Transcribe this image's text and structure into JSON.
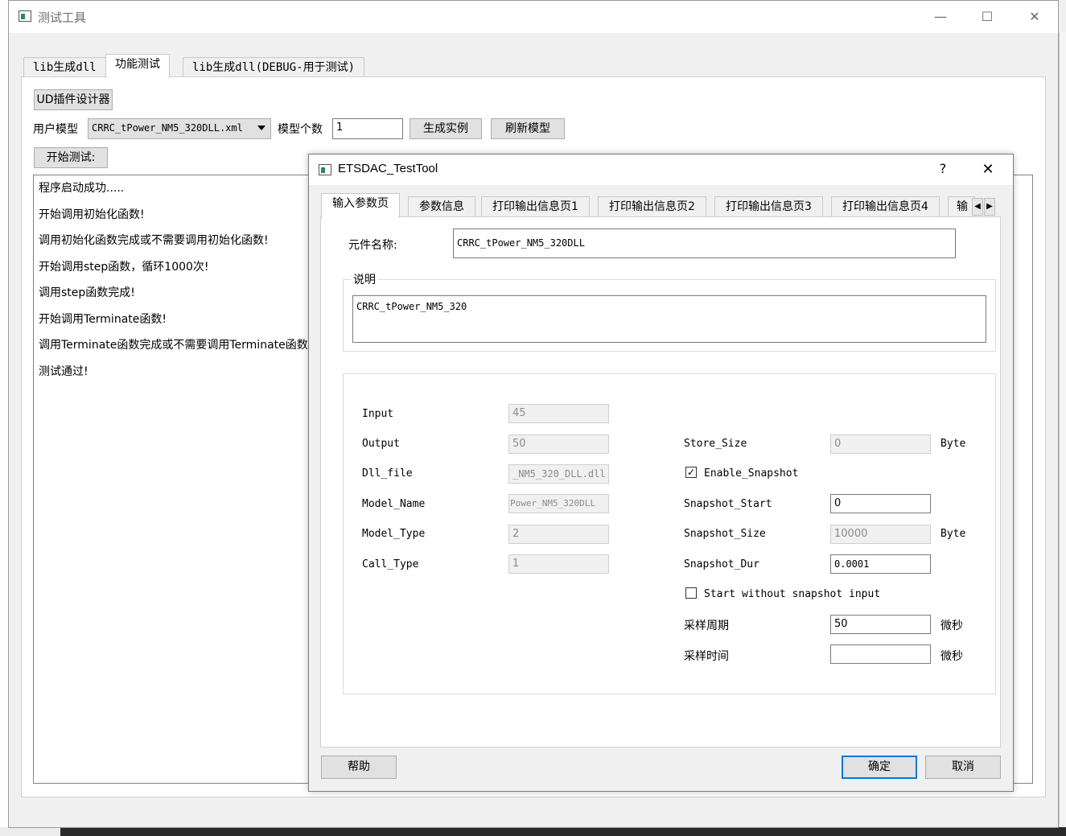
{
  "main_window": {
    "title": "测试工具",
    "controls": {
      "minimize": "—",
      "maximize": "☐",
      "close": "✕"
    },
    "tabs": [
      "lib生成dll",
      "功能测试",
      "lib生成dll(DEBUG-用于测试)"
    ],
    "active_tab": "功能测试",
    "ud_designer_button": "UD插件设计器",
    "user_model_label": "用户模型",
    "user_model_value": "CRRC_tPower_NM5_320DLL.xml",
    "model_count_label": "模型个数",
    "model_count_value": "1",
    "generate_instance_button": "生成实例",
    "refresh_model_button": "刷新模型",
    "start_test_button": "开始测试:",
    "log_lines": [
      "程序启动成功.....",
      "开始调用初始化函数!",
      "调用初始化函数完成或不需要调用初始化函数!",
      "开始调用step函数，循环1000次!",
      "调用step函数完成!",
      "开始调用Terminate函数!",
      "调用Terminate函数完成或不需要调用Terminate函数!",
      "测试通过!"
    ]
  },
  "dialog": {
    "title": "ETSDAC_TestTool",
    "help_glyph": "?",
    "close_glyph": "✕",
    "tabs": [
      "输入参数页",
      "参数信息",
      "打印输出信息页1",
      "打印输出信息页2",
      "打印输出信息页3",
      "打印输出信息页4",
      "输"
    ],
    "active_tab": "输入参数页",
    "component_name_label": "元件名称:",
    "component_name_value": "CRRC_tPower_NM5_320DLL",
    "description_group_title": "说明",
    "description_value": "CRRC_tPower_NM5_320",
    "left_fields": [
      {
        "label": "Input",
        "value": "45"
      },
      {
        "label": "Output",
        "value": "50"
      },
      {
        "label": "Dll_file",
        "value": "_NM5_320_DLL.dll"
      },
      {
        "label": "Model_Name",
        "value": "Power_NM5_320DLL"
      },
      {
        "label": "Model_Type",
        "value": "2"
      },
      {
        "label": "Call_Type",
        "value": "1"
      }
    ],
    "store_size": {
      "label": "Store_Size",
      "value": "0",
      "unit": "Byte"
    },
    "enable_snapshot": {
      "label": "Enable_Snapshot",
      "checked": true,
      "mark": "✓"
    },
    "snapshot_start": {
      "label": "Snapshot_Start",
      "value": "0"
    },
    "snapshot_size": {
      "label": "Snapshot_Size",
      "value": "10000",
      "unit": "Byte"
    },
    "snapshot_dur": {
      "label": "Snapshot_Dur",
      "value": "0.0001"
    },
    "start_without_snapshot": {
      "label": "Start without snapshot input",
      "checked": false
    },
    "sample_period": {
      "label": "采样周期",
      "value": "50",
      "unit": "微秒"
    },
    "sample_time": {
      "label": "采样时间",
      "value": "",
      "unit": "微秒"
    },
    "help_button": "帮助",
    "ok_button": "确定",
    "cancel_button": "取消",
    "scroll_left": "◀",
    "scroll_right": "▶"
  },
  "colors": {
    "accent": "#0078d7",
    "window_bg": "#f0f0f0",
    "panel_bg": "#ffffff"
  }
}
